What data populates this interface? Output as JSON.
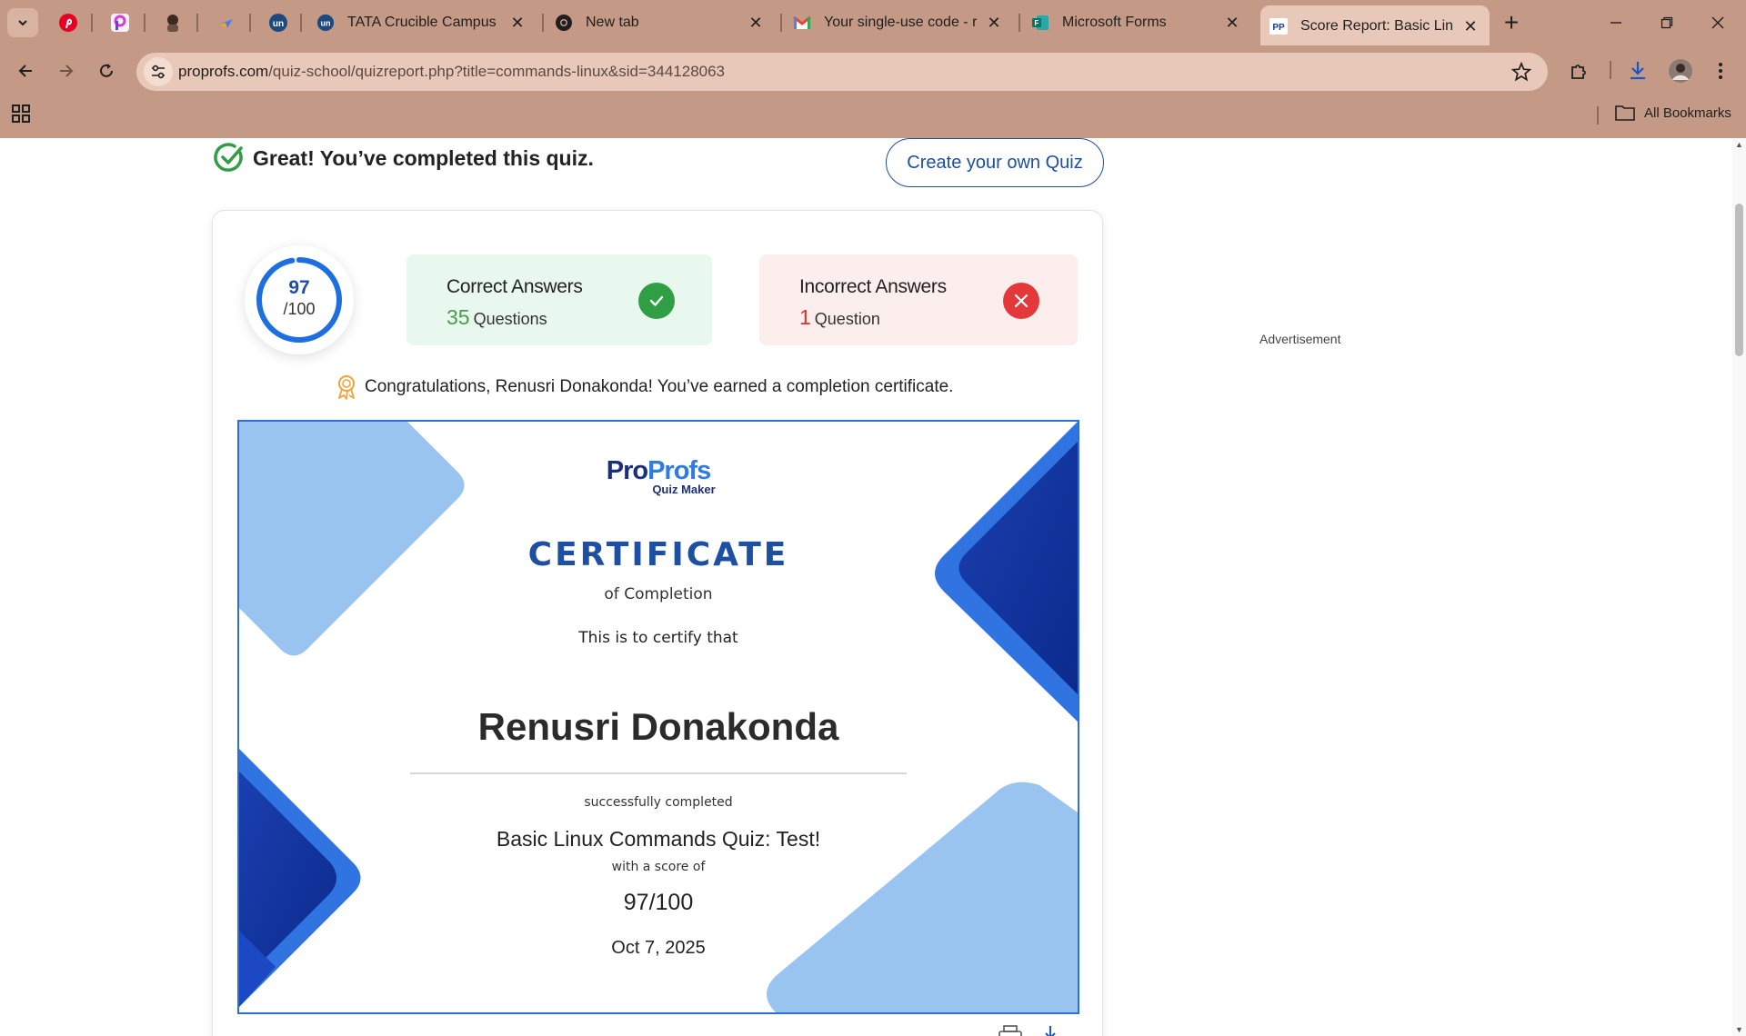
{
  "browser": {
    "tabs": [
      {
        "title": "TATA Crucible Campus Qu"
      },
      {
        "title": "New tab"
      },
      {
        "title": "Your single-use code - ren"
      },
      {
        "title": "Microsoft Forms"
      },
      {
        "title": "Score Report: Basic Linux C"
      }
    ],
    "url_host": "proprofs.com",
    "url_path": "/quiz-school/quizreport.php?title=commands-linux&sid=344128063",
    "all_bookmarks": "All Bookmarks"
  },
  "header": {
    "completed_text": "Great! You’ve completed this quiz.",
    "create_button": "Create your own Quiz"
  },
  "score": {
    "value": "97",
    "max": "/100",
    "fraction": 0.97
  },
  "stats": {
    "correct_title": "Correct Answers",
    "correct_count": "35",
    "correct_unit": "Questions",
    "incorrect_title": "Incorrect Answers",
    "incorrect_count": "1",
    "incorrect_unit": "Question"
  },
  "congrats": "Congratulations, Renusri Donakonda! You’ve earned a completion certificate.",
  "certificate": {
    "logo_pro": "Pro",
    "logo_profs": "Profs",
    "logo_sub": "Quiz Maker",
    "title": "CERTIFICATE",
    "subtitle": "of Completion",
    "certify": "This is to certify that",
    "name": "Renusri Donakonda",
    "completed": "successfully completed",
    "quiz": "Basic Linux Commands Quiz: Test!",
    "with_score": "with a score of",
    "score": "97/100",
    "date": "Oct 7, 2025"
  },
  "sidebar": {
    "ad_label": "Advertisement"
  },
  "colors": {
    "chrome": "#c49a87",
    "brand_blue": "#1d4fa2",
    "correct_green": "#2f9e44",
    "incorrect_red": "#e5383b"
  }
}
